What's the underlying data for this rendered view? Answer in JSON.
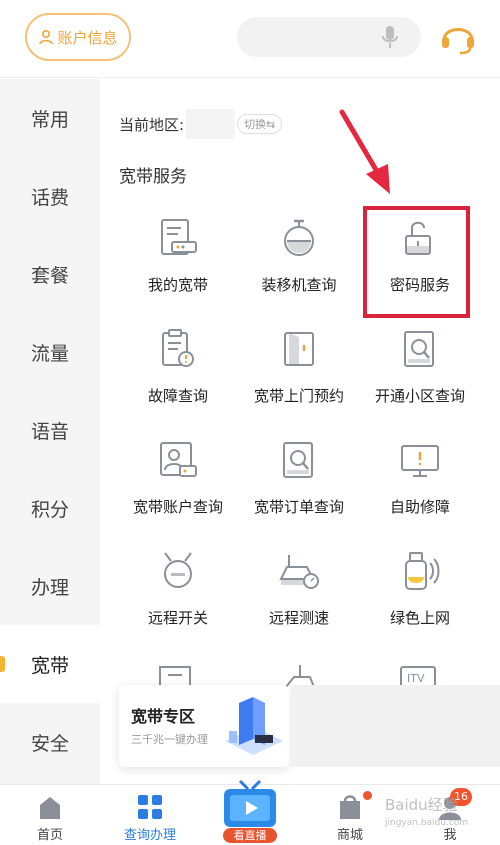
{
  "header": {
    "account_label": "账户信息",
    "search_placeholder": ""
  },
  "sidebar": {
    "items": [
      {
        "label": "常用"
      },
      {
        "label": "话费"
      },
      {
        "label": "套餐"
      },
      {
        "label": "流量"
      },
      {
        "label": "语音"
      },
      {
        "label": "积分"
      },
      {
        "label": "办理"
      },
      {
        "label": "宽带",
        "active": true
      },
      {
        "label": "安全"
      }
    ]
  },
  "main": {
    "region_label": "当前地区:",
    "switch_label": "切换⇆",
    "section_title": "宽带服务",
    "services": [
      {
        "label": "我的宽带",
        "icon": "broadband-doc-icon"
      },
      {
        "label": "装移机查询",
        "icon": "stopwatch-icon"
      },
      {
        "label": "密码服务",
        "icon": "unlock-icon"
      },
      {
        "label": "故障查询",
        "icon": "fault-clipboard-icon"
      },
      {
        "label": "宽带上门预约",
        "icon": "door-booking-icon"
      },
      {
        "label": "开通小区查询",
        "icon": "area-search-icon"
      },
      {
        "label": "宽带账户查询",
        "icon": "account-card-icon"
      },
      {
        "label": "宽带订单查询",
        "icon": "order-search-icon"
      },
      {
        "label": "自助修障",
        "icon": "monitor-alert-icon"
      },
      {
        "label": "远程开关",
        "icon": "remote-switch-icon"
      },
      {
        "label": "远程测速",
        "icon": "speed-router-icon"
      },
      {
        "label": "绿色上网",
        "icon": "green-net-icon"
      }
    ],
    "promo": {
      "title": "宽带专区",
      "subtitle": "三千兆一键办理"
    }
  },
  "bottom_nav": {
    "items": [
      {
        "label": "首页",
        "icon": "home-icon"
      },
      {
        "label": "查询办理",
        "icon": "grid-icon",
        "active": true
      },
      {
        "label": "看直播",
        "icon": "tv-icon"
      },
      {
        "label": "商城",
        "icon": "shopping-bag-icon"
      },
      {
        "label": "我",
        "icon": "user-icon"
      }
    ],
    "my_badge": "16",
    "watermark": "Baidu经验",
    "watermark_sub": "jingyan.baidu.com"
  },
  "colors": {
    "accent": "#f0a53a",
    "highlight": "#d9233a",
    "active_nav": "#2b7de1",
    "sidebar_bg": "#f5f5f5"
  }
}
